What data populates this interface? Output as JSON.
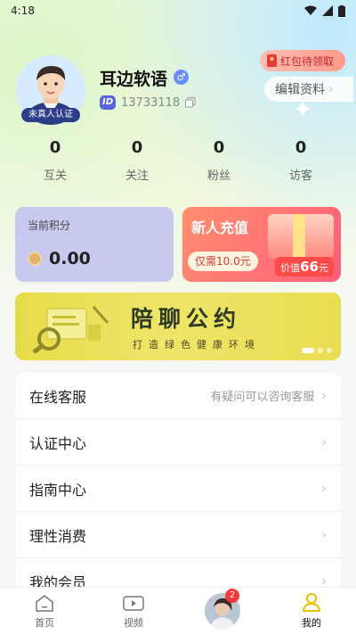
{
  "status_bar": {
    "time": "4:18"
  },
  "profile": {
    "nickname": "耳边软语",
    "gender_symbol": "♂",
    "id_badge": "ID",
    "user_id": "13733118",
    "verify_tag": "未真人认证",
    "redpack_label": "红包待领取",
    "edit_label": "编辑资料"
  },
  "stats": [
    {
      "value": "0",
      "label": "互关"
    },
    {
      "value": "0",
      "label": "关注"
    },
    {
      "value": "0",
      "label": "粉丝"
    },
    {
      "value": "0",
      "label": "访客"
    }
  ],
  "points": {
    "label": "当前积分",
    "value": "0.00"
  },
  "recharge": {
    "title": "新人充值",
    "price_label": "仅需10.0元",
    "value_prefix": "价值",
    "value_amount": "66",
    "value_suffix": "元"
  },
  "banner": {
    "title": "陪聊公约",
    "subtitle": "打造绿色健康环境"
  },
  "menu": [
    {
      "label": "在线客服",
      "hint": "有疑问可以咨询客服"
    },
    {
      "label": "认证中心",
      "hint": ""
    },
    {
      "label": "指南中心",
      "hint": ""
    },
    {
      "label": "理性消费",
      "hint": ""
    },
    {
      "label": "我的会员",
      "hint": ""
    }
  ],
  "bottom_nav": {
    "home": "首页",
    "video": "视频",
    "mine": "我的",
    "message_badge": "2"
  },
  "colors": {
    "accent_blue": "#5a63e0",
    "points_card": "#c8c9ef",
    "banner_yellow": "#e6dc4a",
    "recharge_red": "#ff5e7a"
  }
}
